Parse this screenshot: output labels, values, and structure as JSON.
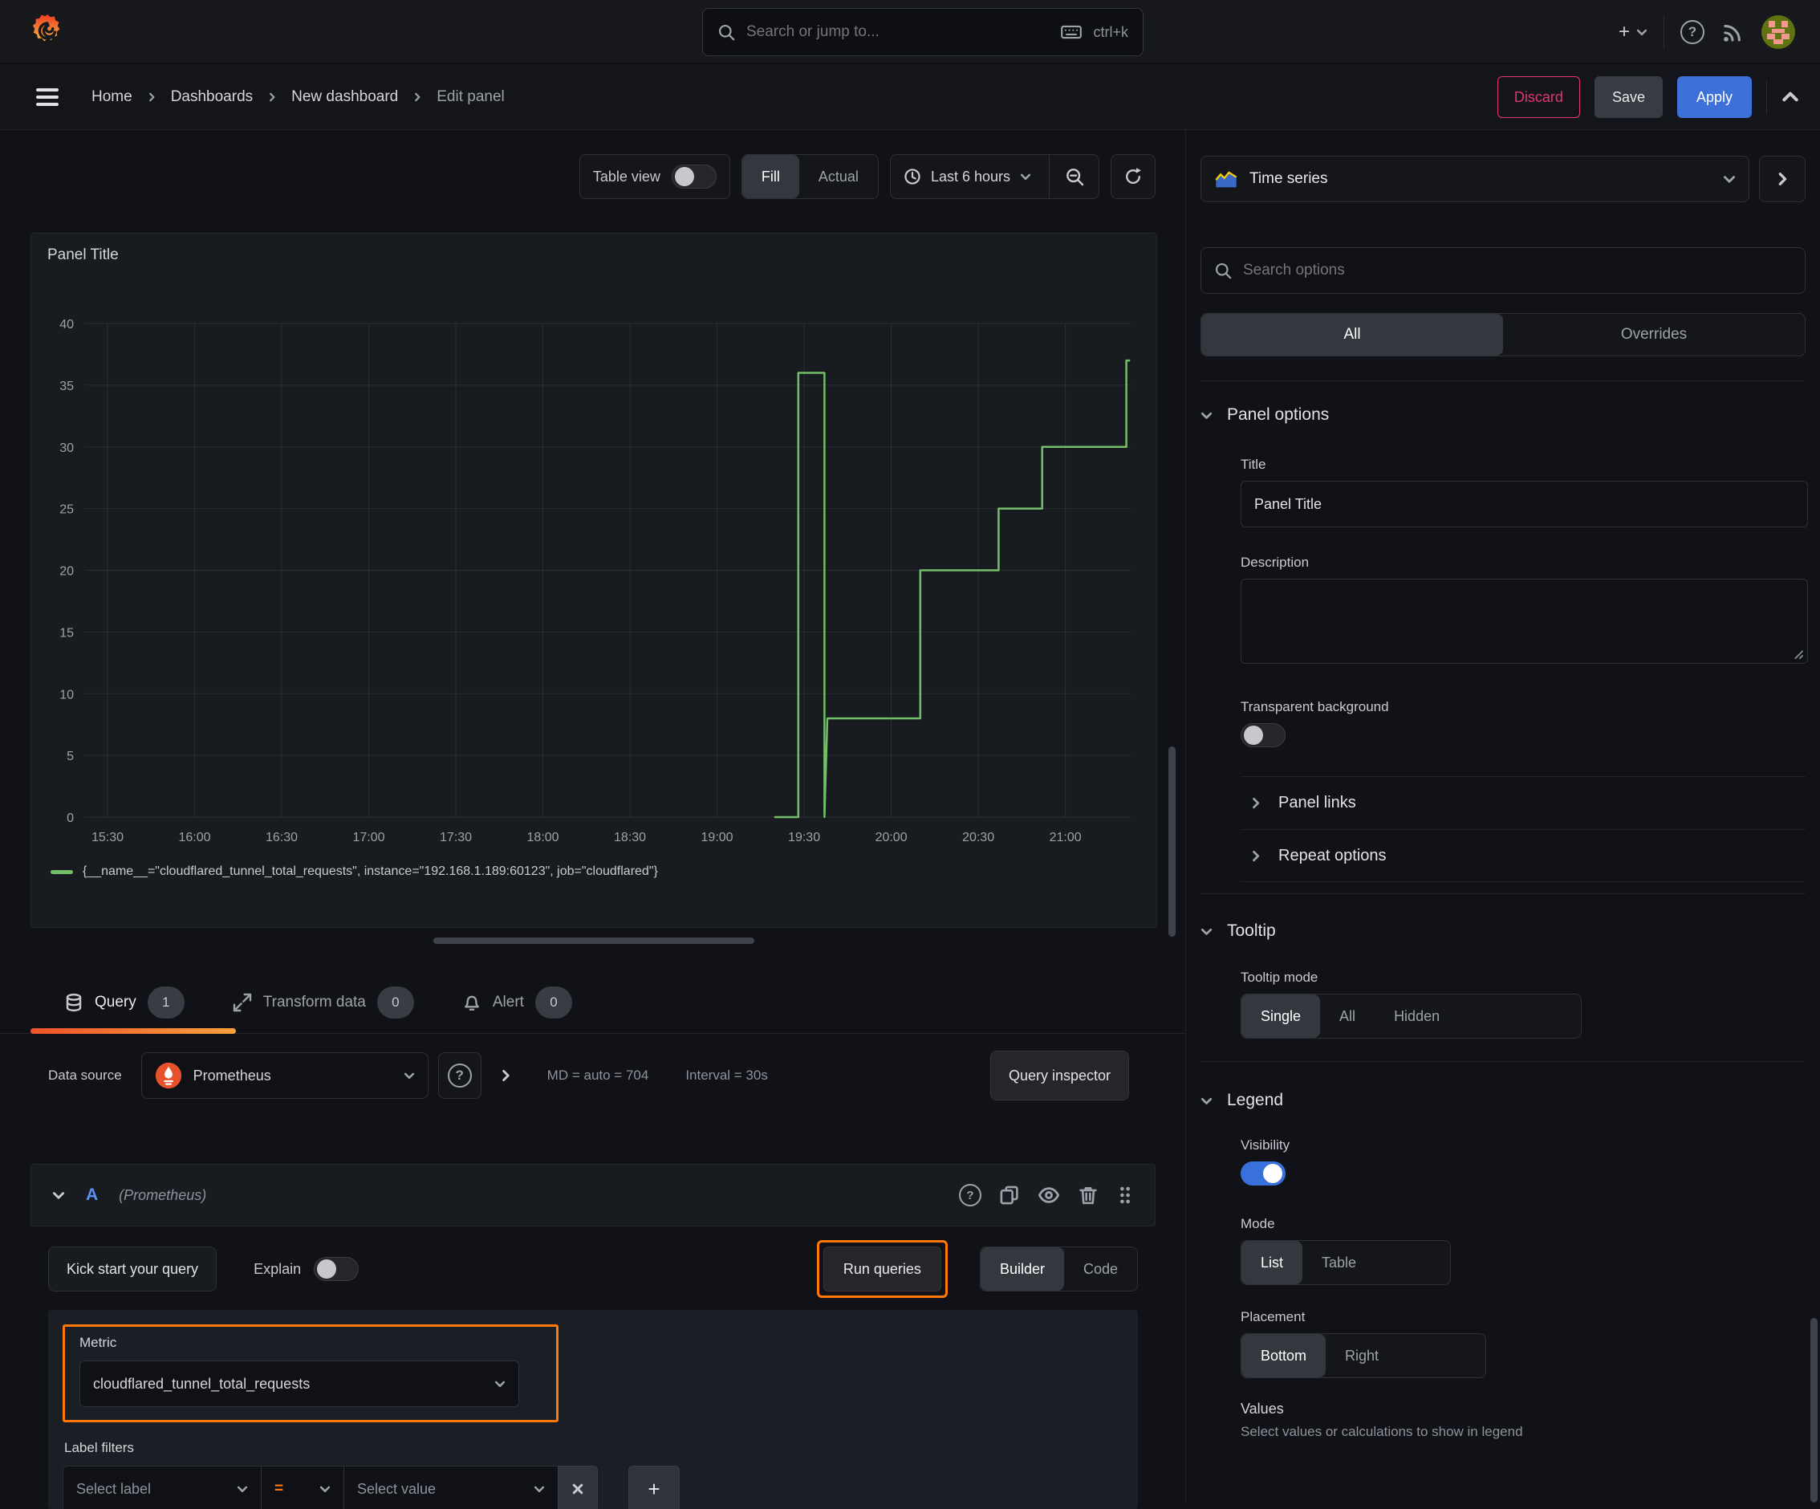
{
  "colors": {
    "accent_orange": "#ff780a",
    "series_green": "#73bf69",
    "primary_blue": "#3d71d9",
    "danger_pink": "#e5356e",
    "toggle_on_blue": "#3871dc",
    "ref_id_blue": "#5794f2"
  },
  "icons": {
    "plus": "+",
    "help": "?",
    "close": "x"
  },
  "topnav": {
    "search_placeholder": "Search or jump to...",
    "shortcut": "ctrl+k"
  },
  "breadcrumb": {
    "items": [
      "Home",
      "Dashboards",
      "New dashboard",
      "Edit panel"
    ]
  },
  "actions": {
    "discard": "Discard",
    "save": "Save",
    "apply": "Apply"
  },
  "toolbar": {
    "table_view": "Table view",
    "fill": "Fill",
    "actual": "Actual",
    "time_range": "Last 6 hours"
  },
  "panel": {
    "title": "Panel Title"
  },
  "chart_data": {
    "type": "line",
    "title": "Panel Title",
    "x_ticks": [
      "15:30",
      "16:00",
      "16:30",
      "17:00",
      "17:30",
      "18:00",
      "18:30",
      "19:00",
      "19:30",
      "20:00",
      "20:30",
      "21:00"
    ],
    "x_tick_interval_minutes": 30,
    "y_ticks": [
      0,
      5,
      10,
      15,
      20,
      25,
      30,
      35,
      40
    ],
    "ylim": [
      0,
      40
    ],
    "grid": true,
    "legend_position": "bottom",
    "series": [
      {
        "name": "{__name__=\"cloudflared_tunnel_total_requests\", instance=\"192.168.1.189:60123\", job=\"cloudflared\"}",
        "color": "#73bf69",
        "points_minutes_from_1530": [
          [
            230,
            0
          ],
          [
            238,
            0
          ],
          [
            238,
            36
          ],
          [
            247,
            36
          ],
          [
            247,
            0
          ],
          [
            248,
            8
          ],
          [
            280,
            8
          ],
          [
            280,
            20
          ],
          [
            307,
            20
          ],
          [
            307,
            25
          ],
          [
            322,
            25
          ],
          [
            322,
            30
          ],
          [
            351,
            30
          ],
          [
            351,
            37
          ],
          [
            352,
            37
          ]
        ]
      }
    ]
  },
  "tabs": {
    "query": "Query",
    "query_count": "1",
    "transform": "Transform data",
    "transform_count": "0",
    "alert": "Alert",
    "alert_count": "0"
  },
  "datasource": {
    "label": "Data source",
    "name": "Prometheus",
    "md_stat": "MD = auto = 704",
    "interval_stat": "Interval = 30s",
    "inspector": "Query inspector"
  },
  "query": {
    "ref_id": "A",
    "ds_hint": "(Prometheus)",
    "kick_start": "Kick start your query",
    "explain": "Explain",
    "run_queries": "Run queries",
    "builder": "Builder",
    "code": "Code",
    "metric_label": "Metric",
    "metric_value": "cloudflared_tunnel_total_requests",
    "label_filters_label": "Label filters",
    "select_label": "Select label",
    "operator": "=",
    "select_value": "Select value"
  },
  "options": {
    "viz_name": "Time series",
    "search_placeholder": "Search options",
    "tab_all": "All",
    "tab_overrides": "Overrides",
    "panel_options": "Panel options",
    "title_label": "Title",
    "title_value": "Panel Title",
    "description_label": "Description",
    "transparent_label": "Transparent background",
    "panel_links": "Panel links",
    "repeat_options": "Repeat options",
    "tooltip_header": "Tooltip",
    "tooltip_mode_label": "Tooltip mode",
    "mode_single": "Single",
    "mode_all": "All",
    "mode_hidden": "Hidden",
    "legend_header": "Legend",
    "visibility_label": "Visibility",
    "mode_label": "Mode",
    "mode_list": "List",
    "mode_table": "Table",
    "placement_label": "Placement",
    "placement_bottom": "Bottom",
    "placement_right": "Right",
    "values_label": "Values",
    "values_hint": "Select values or calculations to show in legend"
  }
}
